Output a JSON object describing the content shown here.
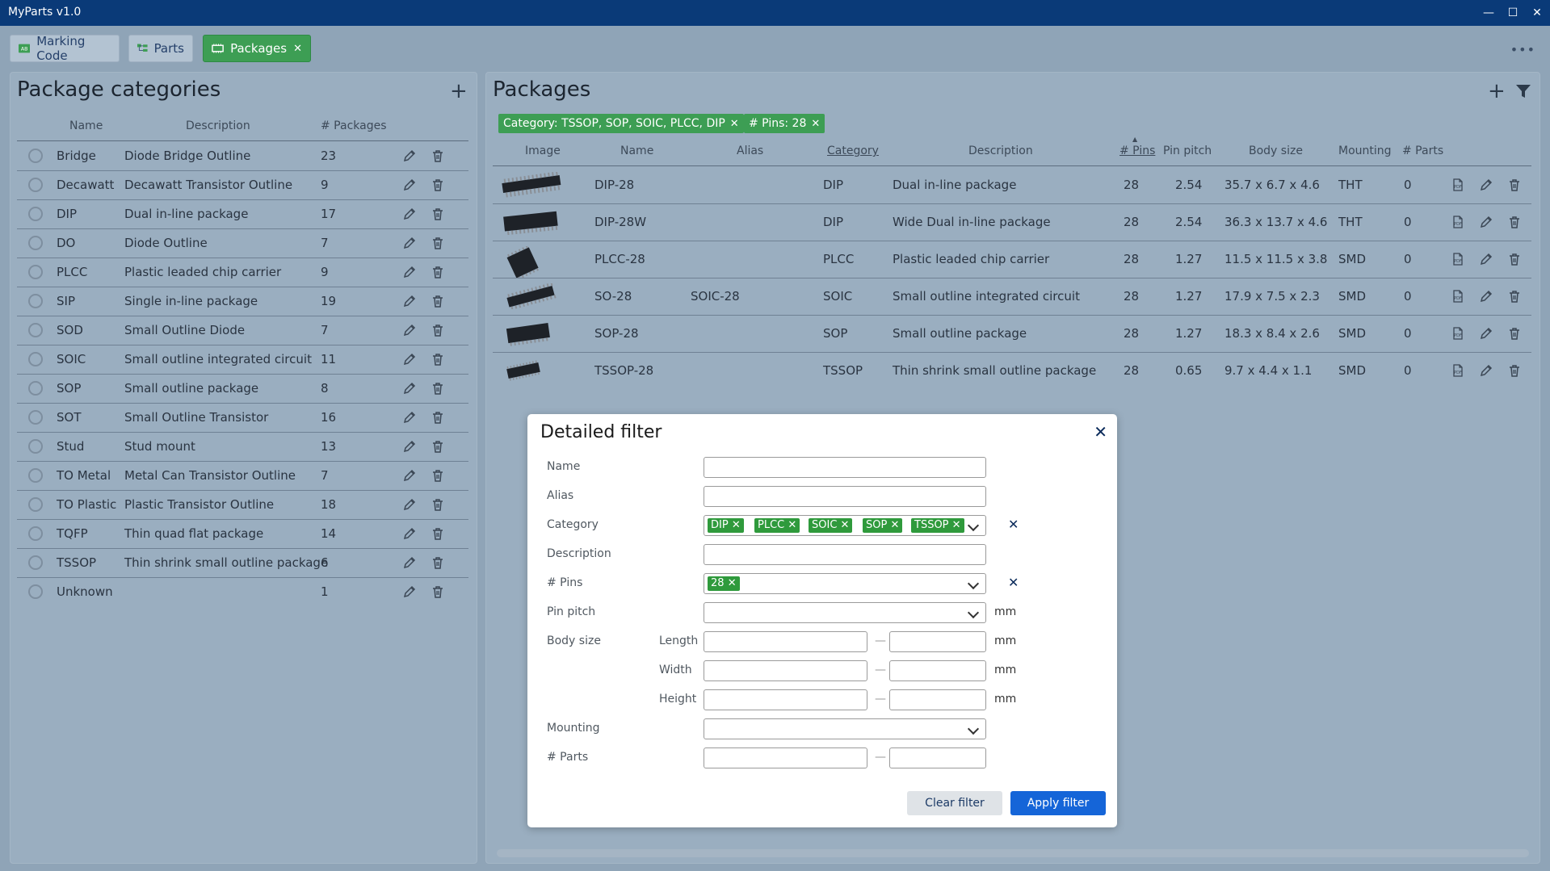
{
  "app": {
    "title": "MyParts v1.0"
  },
  "window_controls": {
    "minimize": "—",
    "maximize": "☐",
    "close": "✕"
  },
  "tabs": [
    {
      "label": "Marking Code",
      "icon": "marking-code-icon",
      "active": false
    },
    {
      "label": "Parts",
      "icon": "parts-tree-icon",
      "active": false
    },
    {
      "label": "Packages",
      "icon": "package-icon",
      "active": true,
      "closable": true
    }
  ],
  "categories_panel": {
    "title": "Package categories",
    "columns": {
      "name": "Name",
      "description": "Description",
      "count": "# Packages"
    },
    "rows": [
      {
        "name": "Bridge",
        "description": "Diode Bridge Outline",
        "count": "23"
      },
      {
        "name": "Decawatt",
        "description": "Decawatt Transistor Outline",
        "count": "9"
      },
      {
        "name": "DIP",
        "description": "Dual in-line package",
        "count": "17"
      },
      {
        "name": "DO",
        "description": "Diode Outline",
        "count": "7"
      },
      {
        "name": "PLCC",
        "description": "Plastic leaded chip carrier",
        "count": "9"
      },
      {
        "name": "SIP",
        "description": "Single in-line package",
        "count": "19"
      },
      {
        "name": "SOD",
        "description": "Small Outline Diode",
        "count": "7"
      },
      {
        "name": "SOIC",
        "description": "Small outline integrated circuit",
        "count": "11"
      },
      {
        "name": "SOP",
        "description": "Small outline package",
        "count": "8"
      },
      {
        "name": "SOT",
        "description": "Small Outline Transistor",
        "count": "16"
      },
      {
        "name": "Stud",
        "description": "Stud mount",
        "count": "13"
      },
      {
        "name": "TO Metal",
        "description": "Metal Can Transistor Outline",
        "count": "7"
      },
      {
        "name": "TO Plastic",
        "description": "Plastic Transistor Outline",
        "count": "18"
      },
      {
        "name": "TQFP",
        "description": "Thin quad flat package",
        "count": "14"
      },
      {
        "name": "TSSOP",
        "description": "Thin shrink small outline package",
        "count": "6"
      },
      {
        "name": "Unknown",
        "description": "",
        "count": "1"
      }
    ]
  },
  "packages_panel": {
    "title": "Packages",
    "filter_chips": [
      "Category: TSSOP, SOP, SOIC, PLCC, DIP",
      "# Pins: 28"
    ],
    "columns": {
      "image": "Image",
      "name": "Name",
      "alias": "Alias",
      "category": "Category",
      "description": "Description",
      "pins": "# Pins",
      "pitch": "Pin pitch",
      "body": "Body size",
      "mounting": "Mounting",
      "parts": "# Parts"
    },
    "rows": [
      {
        "name": "DIP-28",
        "alias": "",
        "category": "DIP",
        "description": "Dual in-line package",
        "pins": "28",
        "pitch": "2.54",
        "body": "35.7 x 6.7 x 4.6",
        "mounting": "THT",
        "parts": "0"
      },
      {
        "name": "DIP-28W",
        "alias": "",
        "category": "DIP",
        "description": "Wide Dual in-line package",
        "pins": "28",
        "pitch": "2.54",
        "body": "36.3 x 13.7 x 4.6",
        "mounting": "THT",
        "parts": "0"
      },
      {
        "name": "PLCC-28",
        "alias": "",
        "category": "PLCC",
        "description": "Plastic leaded chip carrier",
        "pins": "28",
        "pitch": "1.27",
        "body": "11.5 x 11.5 x 3.8",
        "mounting": "SMD",
        "parts": "0"
      },
      {
        "name": "SO-28",
        "alias": "SOIC-28",
        "category": "SOIC",
        "description": "Small outline integrated circuit",
        "pins": "28",
        "pitch": "1.27",
        "body": "17.9 x 7.5 x 2.3",
        "mounting": "SMD",
        "parts": "0"
      },
      {
        "name": "SOP-28",
        "alias": "",
        "category": "SOP",
        "description": "Small outline package",
        "pins": "28",
        "pitch": "1.27",
        "body": "18.3 x 8.4 x 2.6",
        "mounting": "SMD",
        "parts": "0"
      },
      {
        "name": "TSSOP-28",
        "alias": "",
        "category": "TSSOP",
        "description": "Thin shrink small outline package",
        "pins": "28",
        "pitch": "0.65",
        "body": "9.7 x 4.4 x 1.1",
        "mounting": "SMD",
        "parts": "0"
      }
    ]
  },
  "dialog": {
    "title": "Detailed filter",
    "labels": {
      "name": "Name",
      "alias": "Alias",
      "category": "Category",
      "description": "Description",
      "pins": "# Pins",
      "pitch": "Pin pitch",
      "body": "Body size",
      "length": "Length",
      "width": "Width",
      "height": "Height",
      "mounting": "Mounting",
      "parts": "# Parts"
    },
    "category_chips": [
      "DIP",
      "PLCC",
      "SOIC",
      "SOP",
      "TSSOP"
    ],
    "pin_chips": [
      "28"
    ],
    "unit": "mm",
    "range_dash": "—",
    "clear_button": "Clear filter",
    "apply_button": "Apply filter"
  },
  "colors": {
    "titlebar": "#0a3a78",
    "accent": "#3d9e54",
    "apply": "#1565d8"
  }
}
